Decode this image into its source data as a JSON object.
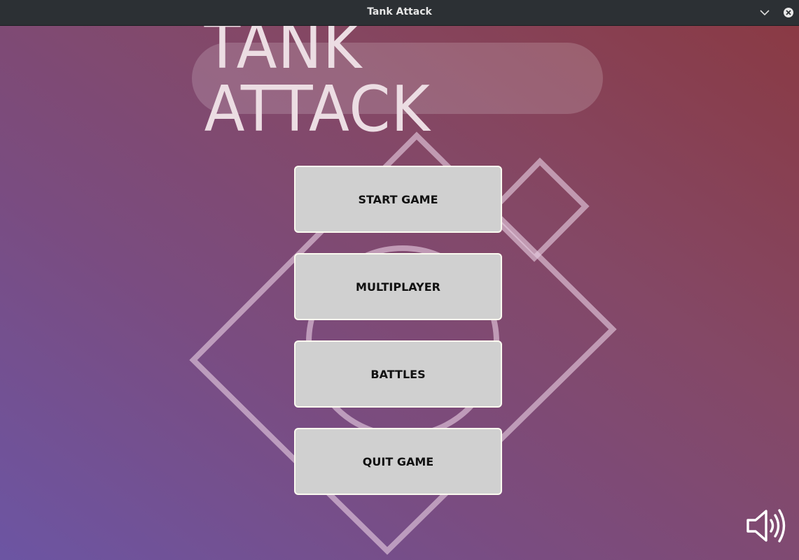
{
  "window": {
    "title": "Tank Attack",
    "minimize_icon": "chevron-down-icon",
    "close_icon": "close-circle-icon"
  },
  "game": {
    "title": "TANK ATTACK"
  },
  "menu": {
    "items": [
      {
        "label": "START GAME"
      },
      {
        "label": "MULTIPLAYER"
      },
      {
        "label": "BATTLES"
      },
      {
        "label": "QUIT GAME"
      }
    ]
  },
  "sound": {
    "icon": "speaker-volume-icon"
  },
  "colors": {
    "gradient_start": "#6c55a3",
    "gradient_end": "#8a3a44",
    "button_fill": "#d0d0d0",
    "button_border": "#fbfbf0",
    "titlebar": "#2c3034"
  }
}
